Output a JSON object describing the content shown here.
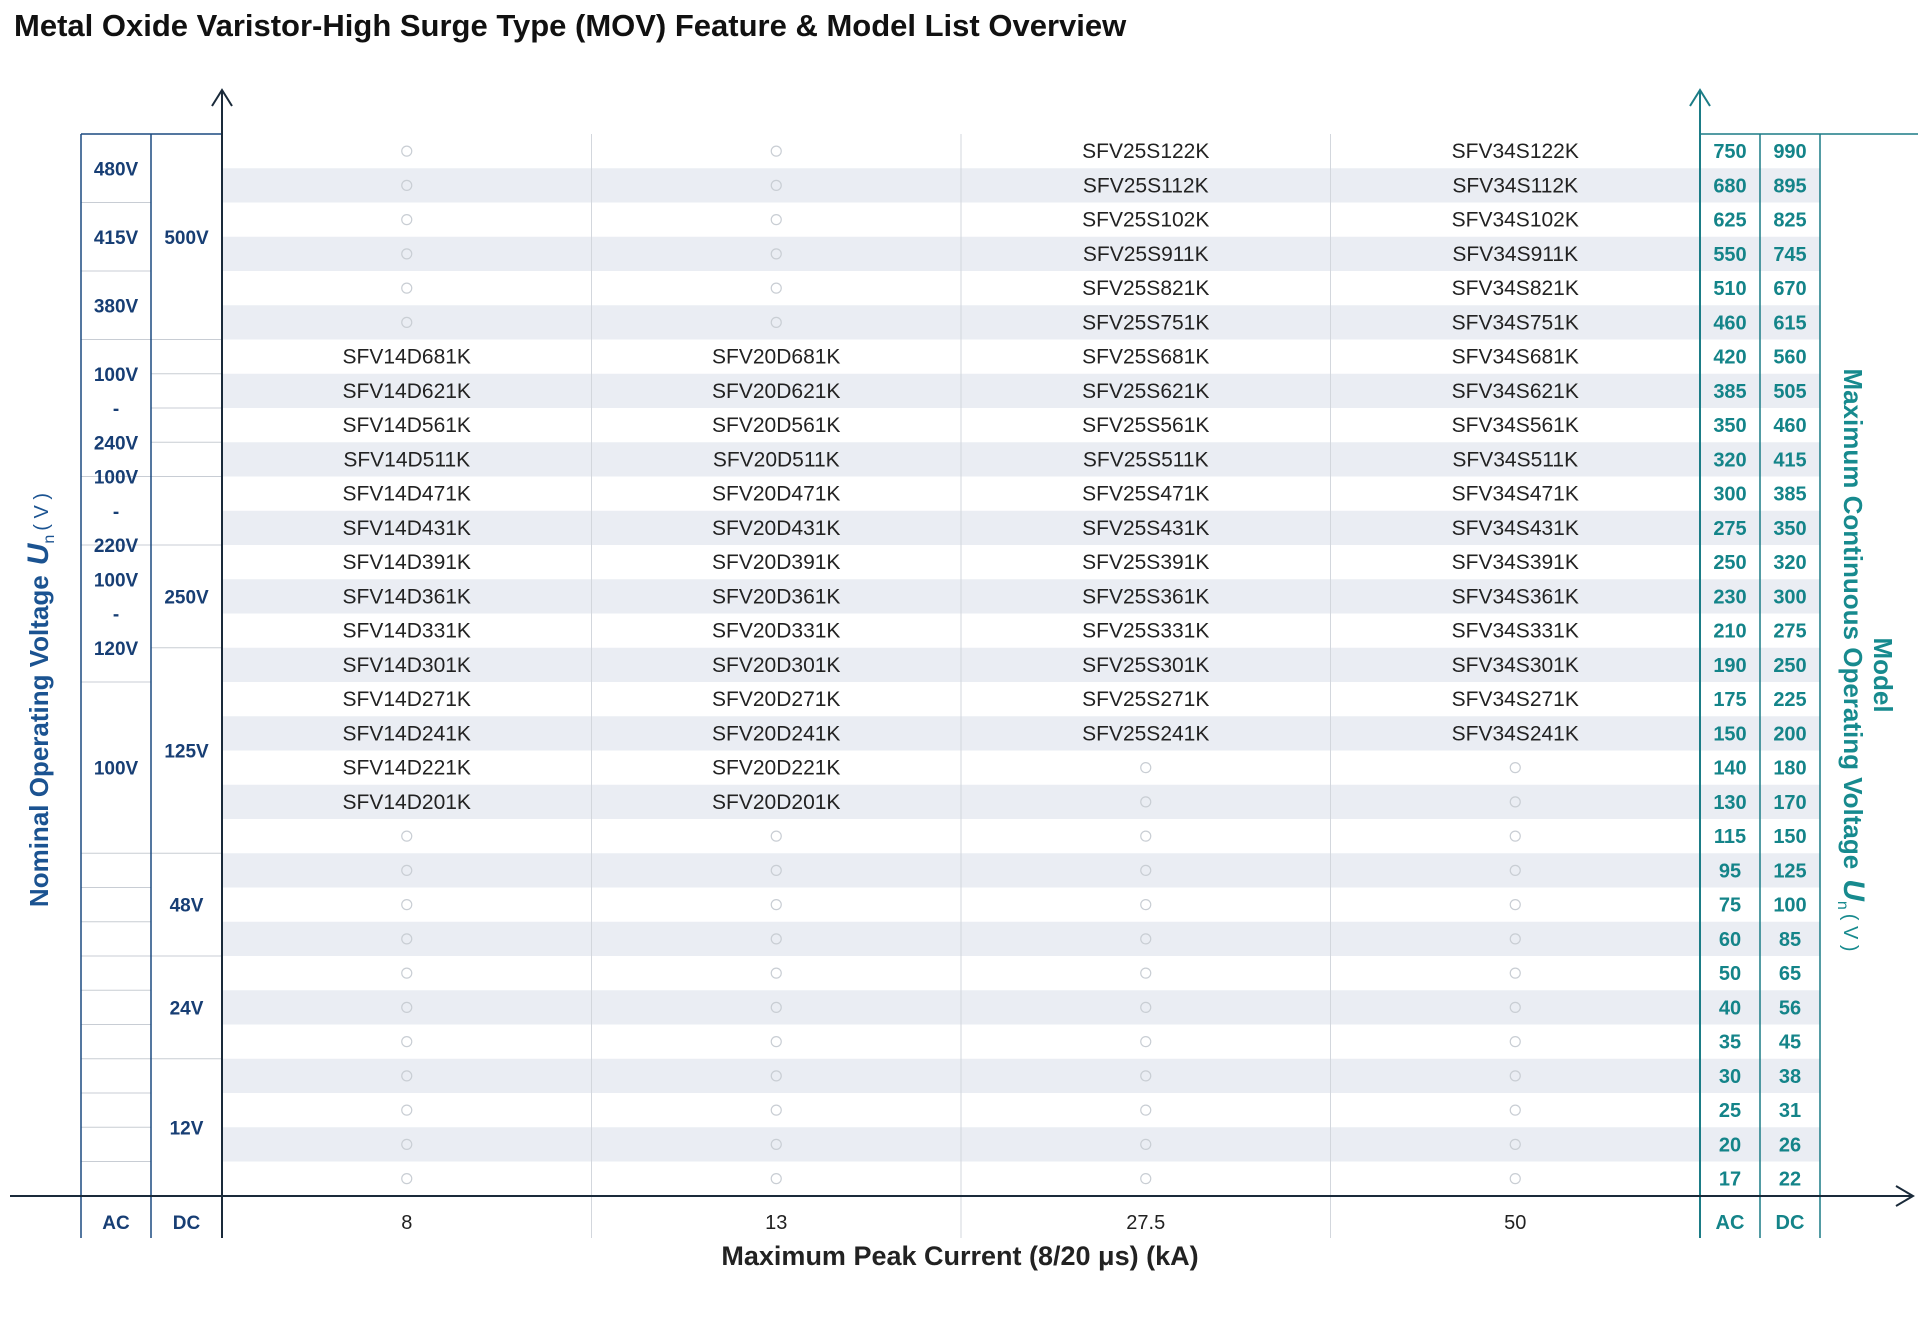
{
  "title": "Metal Oxide Varistor-High Surge Type (MOV) Feature & Model List Overview",
  "x_axis": {
    "label": "Maximum Peak Current (8/20 μs) (kA)",
    "ticks": [
      "8",
      "13",
      "27.5",
      "50"
    ]
  },
  "left_axis": {
    "label_text": "Nominal Operating Voltage",
    "symbol": "U",
    "subscript": "n",
    "unit": "( V )",
    "footer": [
      "AC",
      "DC"
    ]
  },
  "right_axis": {
    "label_model": "Model",
    "label_text": "Maximum Continuous Operating Voltage",
    "symbol": "U",
    "subscript": "n",
    "unit": "( V )",
    "footer": [
      "AC",
      "DC"
    ]
  },
  "empty_marker": "○",
  "rows": [
    {
      "ac": "750",
      "dc": "990",
      "models": [
        null,
        null,
        "SFV25S122K",
        "SFV34S122K"
      ]
    },
    {
      "ac": "680",
      "dc": "895",
      "models": [
        null,
        null,
        "SFV25S112K",
        "SFV34S112K"
      ]
    },
    {
      "ac": "625",
      "dc": "825",
      "models": [
        null,
        null,
        "SFV25S102K",
        "SFV34S102K"
      ]
    },
    {
      "ac": "550",
      "dc": "745",
      "models": [
        null,
        null,
        "SFV25S911K",
        "SFV34S911K"
      ]
    },
    {
      "ac": "510",
      "dc": "670",
      "models": [
        null,
        null,
        "SFV25S821K",
        "SFV34S821K"
      ]
    },
    {
      "ac": "460",
      "dc": "615",
      "models": [
        null,
        null,
        "SFV25S751K",
        "SFV34S751K"
      ]
    },
    {
      "ac": "420",
      "dc": "560",
      "models": [
        "SFV14D681K",
        "SFV20D681K",
        "SFV25S681K",
        "SFV34S681K"
      ]
    },
    {
      "ac": "385",
      "dc": "505",
      "models": [
        "SFV14D621K",
        "SFV20D621K",
        "SFV25S621K",
        "SFV34S621K"
      ]
    },
    {
      "ac": "350",
      "dc": "460",
      "models": [
        "SFV14D561K",
        "SFV20D561K",
        "SFV25S561K",
        "SFV34S561K"
      ]
    },
    {
      "ac": "320",
      "dc": "415",
      "models": [
        "SFV14D511K",
        "SFV20D511K",
        "SFV25S511K",
        "SFV34S511K"
      ]
    },
    {
      "ac": "300",
      "dc": "385",
      "models": [
        "SFV14D471K",
        "SFV20D471K",
        "SFV25S471K",
        "SFV34S471K"
      ]
    },
    {
      "ac": "275",
      "dc": "350",
      "models": [
        "SFV14D431K",
        "SFV20D431K",
        "SFV25S431K",
        "SFV34S431K"
      ]
    },
    {
      "ac": "250",
      "dc": "320",
      "models": [
        "SFV14D391K",
        "SFV20D391K",
        "SFV25S391K",
        "SFV34S391K"
      ]
    },
    {
      "ac": "230",
      "dc": "300",
      "models": [
        "SFV14D361K",
        "SFV20D361K",
        "SFV25S361K",
        "SFV34S361K"
      ]
    },
    {
      "ac": "210",
      "dc": "275",
      "models": [
        "SFV14D331K",
        "SFV20D331K",
        "SFV25S331K",
        "SFV34S331K"
      ]
    },
    {
      "ac": "190",
      "dc": "250",
      "models": [
        "SFV14D301K",
        "SFV20D301K",
        "SFV25S301K",
        "SFV34S301K"
      ]
    },
    {
      "ac": "175",
      "dc": "225",
      "models": [
        "SFV14D271K",
        "SFV20D271K",
        "SFV25S271K",
        "SFV34S271K"
      ]
    },
    {
      "ac": "150",
      "dc": "200",
      "models": [
        "SFV14D241K",
        "SFV20D241K",
        "SFV25S241K",
        "SFV34S241K"
      ]
    },
    {
      "ac": "140",
      "dc": "180",
      "models": [
        "SFV14D221K",
        "SFV20D221K",
        null,
        null
      ]
    },
    {
      "ac": "130",
      "dc": "170",
      "models": [
        "SFV14D201K",
        "SFV20D201K",
        null,
        null
      ]
    },
    {
      "ac": "115",
      "dc": "150",
      "models": [
        null,
        null,
        null,
        null
      ]
    },
    {
      "ac": "95",
      "dc": "125",
      "models": [
        null,
        null,
        null,
        null
      ]
    },
    {
      "ac": "75",
      "dc": "100",
      "models": [
        null,
        null,
        null,
        null
      ]
    },
    {
      "ac": "60",
      "dc": "85",
      "models": [
        null,
        null,
        null,
        null
      ]
    },
    {
      "ac": "50",
      "dc": "65",
      "models": [
        null,
        null,
        null,
        null
      ]
    },
    {
      "ac": "40",
      "dc": "56",
      "models": [
        null,
        null,
        null,
        null
      ]
    },
    {
      "ac": "35",
      "dc": "45",
      "models": [
        null,
        null,
        null,
        null
      ]
    },
    {
      "ac": "30",
      "dc": "38",
      "models": [
        null,
        null,
        null,
        null
      ]
    },
    {
      "ac": "25",
      "dc": "31",
      "models": [
        null,
        null,
        null,
        null
      ]
    },
    {
      "ac": "20",
      "dc": "26",
      "models": [
        null,
        null,
        null,
        null
      ]
    },
    {
      "ac": "17",
      "dc": "22",
      "models": [
        null,
        null,
        null,
        null
      ]
    }
  ],
  "ac_groups": [
    {
      "lines": [
        "480V"
      ],
      "rows": [
        0,
        1
      ]
    },
    {
      "lines": [
        "415V"
      ],
      "rows": [
        2,
        3
      ]
    },
    {
      "lines": [
        "380V"
      ],
      "rows": [
        4,
        5
      ]
    },
    {
      "lines": [
        "100V",
        "-",
        "240V"
      ],
      "rows": [
        6,
        9
      ]
    },
    {
      "lines": [
        "100V",
        "-",
        "220V"
      ],
      "rows": [
        10,
        11
      ]
    },
    {
      "lines": [
        "100V",
        "-",
        "120V"
      ],
      "rows": [
        12,
        15
      ]
    },
    {
      "lines": [
        "100V"
      ],
      "rows": [
        16,
        20
      ]
    },
    {
      "lines": [],
      "rows": [
        21,
        21
      ]
    },
    {
      "lines": [],
      "rows": [
        22,
        22
      ]
    },
    {
      "lines": [],
      "rows": [
        23,
        23
      ]
    },
    {
      "lines": [],
      "rows": [
        24,
        24
      ]
    },
    {
      "lines": [],
      "rows": [
        25,
        25
      ]
    },
    {
      "lines": [],
      "rows": [
        26,
        26
      ]
    },
    {
      "lines": [],
      "rows": [
        27,
        27
      ]
    },
    {
      "lines": [],
      "rows": [
        28,
        28
      ]
    },
    {
      "lines": [],
      "rows": [
        29,
        29
      ]
    },
    {
      "lines": [],
      "rows": [
        30,
        30
      ]
    }
  ],
  "dc_groups": [
    {
      "lines": [
        "500V"
      ],
      "rows": [
        0,
        5
      ]
    },
    {
      "lines": [],
      "rows": [
        6,
        6
      ]
    },
    {
      "lines": [],
      "rows": [
        7,
        7
      ]
    },
    {
      "lines": [],
      "rows": [
        8,
        8
      ]
    },
    {
      "lines": [],
      "rows": [
        9,
        9
      ]
    },
    {
      "lines": [],
      "rows": [
        10,
        11
      ]
    },
    {
      "lines": [
        "250V"
      ],
      "rows": [
        12,
        14
      ]
    },
    {
      "lines": [
        "125V"
      ],
      "rows": [
        15,
        20
      ]
    },
    {
      "lines": [
        "48V"
      ],
      "rows": [
        21,
        23
      ]
    },
    {
      "lines": [
        "24V"
      ],
      "rows": [
        24,
        26
      ]
    },
    {
      "lines": [
        "12V"
      ],
      "rows": [
        27,
        30
      ]
    }
  ],
  "colors": {
    "navy": "#1b4a80",
    "teal": "#1b7c86",
    "stripe": "#eaedf3",
    "axis": "#1a2a3a"
  }
}
